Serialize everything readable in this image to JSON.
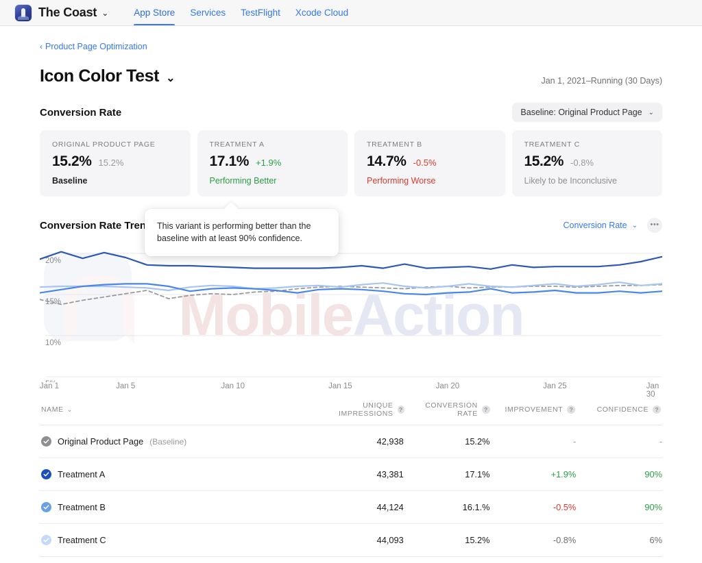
{
  "topbar": {
    "app_icon": "lighthouse-app-icon",
    "brand": "The Coast",
    "brand_chevron": "⌄",
    "nav": [
      {
        "label": "App Store",
        "active": true
      },
      {
        "label": "Services",
        "active": false
      },
      {
        "label": "TestFlight",
        "active": false
      },
      {
        "label": "Xcode Cloud",
        "active": false
      }
    ]
  },
  "breadcrumb": {
    "chevron": "‹",
    "label": "Product Page Optimization"
  },
  "header": {
    "title": "Icon Color Test",
    "chevron": "⌄",
    "date_range": "Jan 1, 2021–Running (30 Days)"
  },
  "conversion_section": {
    "title": "Conversion Rate",
    "baseline_select": {
      "label": "Baseline: Original Product Page",
      "chevron": "⌄"
    }
  },
  "cards": [
    {
      "label": "ORIGINAL PRODUCT PAGE",
      "value": "15.2%",
      "delta": "15.2%",
      "delta_tone": "mut",
      "status": "Baseline",
      "status_tone": "base"
    },
    {
      "label": "TREATMENT A",
      "value": "17.1%",
      "delta": "+1.9%",
      "delta_tone": "pos",
      "status": "Performing Better",
      "status_tone": "pos"
    },
    {
      "label": "TREATMENT B",
      "value": "14.7%",
      "delta": "-0.5%",
      "delta_tone": "neg",
      "status": "Performing Worse",
      "status_tone": "neg"
    },
    {
      "label": "TREATMENT C",
      "value": "15.2%",
      "delta": "-0.8%",
      "delta_tone": "mut",
      "status": "Likely to be Inconclusive",
      "status_tone": "mut"
    }
  ],
  "tooltip": {
    "text": "This variant is performing better than the baseline with at least 90% confidence."
  },
  "chart_header": {
    "title": "Conversion Rate Trend",
    "metric_select": {
      "label": "Conversion Rate",
      "chevron": "⌄"
    },
    "more_icon": "ellipsis-icon",
    "more_label": "•••"
  },
  "watermark": {
    "text_a": "Mobile",
    "text_b": "Action"
  },
  "chart_data": {
    "type": "line",
    "title": "Conversion Rate Trend",
    "xlabel": "",
    "ylabel": "Conversion Rate",
    "ylim": [
      5,
      21.5
    ],
    "xlim": [
      1,
      30
    ],
    "grid": true,
    "legend_position": "none",
    "yticks": [
      "5%",
      "10%",
      "15%",
      "20%"
    ],
    "ytick_values": [
      5,
      10,
      15,
      20
    ],
    "xticks": [
      "Jan 1",
      "Jan 5",
      "Jan 10",
      "Jan 15",
      "Jan 20",
      "Jan 25",
      "Jan 30"
    ],
    "xtick_values": [
      1,
      5,
      10,
      15,
      20,
      25,
      30
    ],
    "x": [
      1,
      2,
      3,
      4,
      5,
      6,
      7,
      8,
      9,
      10,
      11,
      12,
      13,
      14,
      15,
      16,
      17,
      18,
      19,
      20,
      21,
      22,
      23,
      24,
      25,
      26,
      27,
      28,
      29,
      30
    ],
    "series": [
      {
        "name": "Treatment A",
        "color": "#2d58b8",
        "style": "solid",
        "values": [
          19.3,
          20.2,
          19.4,
          20.1,
          19.5,
          18.6,
          18.5,
          18.5,
          18.4,
          18.3,
          18.2,
          18.2,
          18.2,
          18.2,
          18.3,
          18.5,
          18.2,
          18.7,
          18.2,
          18.3,
          18.4,
          18.1,
          18.6,
          18.3,
          18.4,
          18.4,
          18.4,
          18.6,
          19.0,
          19.6
        ]
      },
      {
        "name": "Treatment B",
        "color": "#4a86e8",
        "style": "solid",
        "values": [
          15.2,
          15.6,
          16.0,
          16.2,
          16.3,
          16.3,
          16.0,
          15.4,
          15.7,
          15.8,
          15.7,
          15.5,
          15.2,
          15.6,
          15.7,
          15.6,
          15.4,
          15.1,
          15.0,
          15.2,
          15.3,
          15.7,
          15.2,
          15.3,
          15.5,
          15.2,
          15.2,
          15.4,
          15.2,
          15.4
        ]
      },
      {
        "name": "Treatment C",
        "color": "#a8c5f2",
        "style": "solid",
        "values": [
          15.9,
          16.0,
          16.0,
          16.0,
          15.9,
          15.8,
          15.5,
          15.9,
          16.1,
          16.0,
          15.7,
          15.8,
          16.0,
          16.1,
          15.9,
          16.2,
          16.4,
          16.0,
          15.8,
          16.0,
          16.3,
          16.0,
          15.9,
          16.1,
          16.3,
          16.0,
          16.2,
          16.5,
          16.1,
          16.3
        ]
      },
      {
        "name": "Original Product Page (Baseline)",
        "color": "#9a9a9e",
        "style": "dashed",
        "values": [
          14.4,
          13.8,
          14.3,
          14.7,
          15.1,
          15.5,
          14.5,
          14.9,
          15.1,
          15.0,
          15.3,
          15.4,
          15.7,
          15.9,
          16.0,
          15.9,
          15.8,
          15.7,
          15.9,
          16.0,
          15.8,
          15.9,
          15.9,
          16.0,
          16.0,
          15.9,
          16.0,
          16.1,
          16.1,
          16.2
        ]
      }
    ]
  },
  "table": {
    "columns": [
      {
        "label": "NAME",
        "sort_icon": "chevron-down-icon",
        "help": false
      },
      {
        "label": "UNIQUE IMPRESSIONS",
        "help": true
      },
      {
        "label": "CONVERSION RATE",
        "help": true
      },
      {
        "label": "IMPROVEMENT",
        "help": true
      },
      {
        "label": "CONFIDENCE",
        "help": true
      }
    ],
    "help_glyph": "?",
    "rows": [
      {
        "dot_color": "#8e8e93",
        "name": "Original Product Page",
        "suffix": "(Baseline)",
        "impressions": "42,938",
        "conversion_rate": "15.2%",
        "improvement": "-",
        "improvement_tone": "dash",
        "confidence": "-",
        "confidence_tone": "dash"
      },
      {
        "dot_color": "#1d4fbb",
        "name": "Treatment A",
        "suffix": "",
        "impressions": "43,381",
        "conversion_rate": "17.1%",
        "improvement": "+1.9%",
        "improvement_tone": "pos",
        "confidence": "90%",
        "confidence_tone": "pos"
      },
      {
        "dot_color": "#6ba0e8",
        "name": "Treatment B",
        "suffix": "",
        "impressions": "44,124",
        "conversion_rate": "16.1.%",
        "improvement": "-0.5%",
        "improvement_tone": "neg",
        "confidence": "90%",
        "confidence_tone": "pos"
      },
      {
        "dot_color": "#c3dbf8",
        "name": "Treatment C",
        "suffix": "",
        "impressions": "44,093",
        "conversion_rate": "15.2%",
        "improvement": "-0.8%",
        "improvement_tone": "mut",
        "confidence": "6%",
        "confidence_tone": "mut"
      }
    ]
  }
}
